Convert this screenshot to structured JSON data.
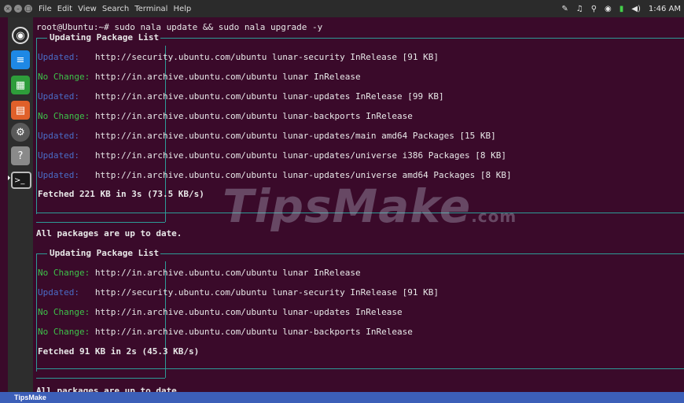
{
  "topbar": {
    "menu": [
      "File",
      "Edit",
      "View",
      "Search",
      "Terminal",
      "Help"
    ],
    "clock": "1:46 AM"
  },
  "launcher": {
    "items": [
      "ubuntu-home",
      "libreoffice-writer",
      "libreoffice-calc",
      "libreoffice-impress",
      "system-settings",
      "help",
      "terminal"
    ]
  },
  "terminal": {
    "prompt": "root@Ubuntu:~# sudo nala update && sudo nala upgrade -y",
    "section1": {
      "title": "Updating Package List",
      "rows": [
        {
          "label": "Updated:   ",
          "kind": "upd",
          "text": "http://security.ubuntu.com/ubuntu lunar-security InRelease [91 KB]"
        },
        {
          "label": "No Change: ",
          "kind": "noc",
          "text": "http://in.archive.ubuntu.com/ubuntu lunar InRelease"
        },
        {
          "label": "Updated:   ",
          "kind": "upd",
          "text": "http://in.archive.ubuntu.com/ubuntu lunar-updates InRelease [99 KB]"
        },
        {
          "label": "No Change: ",
          "kind": "noc",
          "text": "http://in.archive.ubuntu.com/ubuntu lunar-backports InRelease"
        },
        {
          "label": "Updated:   ",
          "kind": "upd",
          "text": "http://in.archive.ubuntu.com/ubuntu lunar-updates/main amd64 Packages [15 KB]"
        },
        {
          "label": "Updated:   ",
          "kind": "upd",
          "text": "http://in.archive.ubuntu.com/ubuntu lunar-updates/universe i386 Packages [8 KB]"
        },
        {
          "label": "Updated:   ",
          "kind": "upd",
          "text": "http://in.archive.ubuntu.com/ubuntu lunar-updates/universe amd64 Packages [8 KB]"
        }
      ],
      "fetched": "Fetched 221 KB in 3s (73.5 KB/s)"
    },
    "up_to_date_1": "All packages are up to date.",
    "section2": {
      "title": "Updating Package List",
      "rows": [
        {
          "label": "No Change: ",
          "kind": "noc",
          "text": "http://in.archive.ubuntu.com/ubuntu lunar InRelease"
        },
        {
          "label": "Updated:   ",
          "kind": "upd",
          "text": "http://security.ubuntu.com/ubuntu lunar-security InRelease [91 KB]"
        },
        {
          "label": "No Change: ",
          "kind": "noc",
          "text": "http://in.archive.ubuntu.com/ubuntu lunar-updates InRelease"
        },
        {
          "label": "No Change: ",
          "kind": "noc",
          "text": "http://in.archive.ubuntu.com/ubuntu lunar-backports InRelease"
        }
      ],
      "fetched": "Fetched 91 KB in 2s (45.3 KB/s)"
    },
    "up_to_date_2": "All packages are up to date."
  },
  "watermark": {
    "brand": "TipsMake",
    "suffix": ".com"
  },
  "footer": {
    "brand": "TipsMake"
  },
  "colors": {
    "updated": "#4a6cc6",
    "no_change": "#3ec14a",
    "frame": "#2d9b96",
    "background": "#3a0a2a"
  }
}
